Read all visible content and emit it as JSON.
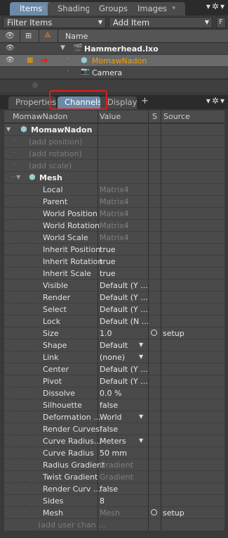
{
  "top_tabs": [
    {
      "label": "Items",
      "active": true
    },
    {
      "label": "Shading",
      "active": false
    },
    {
      "label": "Groups",
      "active": false
    },
    {
      "label": "Images",
      "active": false
    }
  ],
  "filter": {
    "label": "Filter Items",
    "add_item": "Add Item",
    "f_button": "F"
  },
  "items_header": {
    "name": "Name"
  },
  "items": [
    {
      "name": "Hammerhead.lxo",
      "type": "scene"
    },
    {
      "name": "MomawNadon",
      "type": "mesh",
      "selected": true
    },
    {
      "name": "Camera",
      "type": "camera"
    }
  ],
  "bottom_tabs": [
    {
      "label": "Properties",
      "active": false
    },
    {
      "label": "Channels",
      "active": true
    },
    {
      "label": "Display",
      "active": false
    },
    {
      "label": "+",
      "active": false
    }
  ],
  "channel_header": {
    "name_col": "MomawNadon",
    "value_col": "Value",
    "s_col": "S",
    "source_col": "Source"
  },
  "channels": [
    {
      "label": "MomawNadon",
      "value": "",
      "style": "bold",
      "indent": 0,
      "icon": "mesh"
    },
    {
      "label": "(add position)",
      "value": "",
      "style": "dim",
      "indent": 1
    },
    {
      "label": "(add rotation)",
      "value": "",
      "style": "dim",
      "indent": 1
    },
    {
      "label": "(add scale)",
      "value": "",
      "style": "dim",
      "indent": 1
    },
    {
      "label": "Mesh",
      "value": "",
      "style": "bold",
      "indent": 1,
      "icon": "mesh"
    },
    {
      "label": "Local",
      "value": "Matrix4",
      "value_dim": true,
      "indent": 2
    },
    {
      "label": "Parent",
      "value": "Matrix4",
      "value_dim": true,
      "indent": 2
    },
    {
      "label": "World Position",
      "value": "Matrix4",
      "value_dim": true,
      "indent": 2
    },
    {
      "label": "World Rotation",
      "value": "Matrix4",
      "value_dim": true,
      "indent": 2
    },
    {
      "label": "World Scale",
      "value": "Matrix4",
      "value_dim": true,
      "indent": 2
    },
    {
      "label": "Inherit Position",
      "value": "true",
      "indent": 2
    },
    {
      "label": "Inherit Rotation",
      "value": "true",
      "indent": 2
    },
    {
      "label": "Inherit Scale",
      "value": "true",
      "indent": 2
    },
    {
      "label": "Visible",
      "value": "Default (Y ...",
      "indent": 2
    },
    {
      "label": "Render",
      "value": "Default (Y ...",
      "indent": 2
    },
    {
      "label": "Select",
      "value": "Default (Y ...",
      "indent": 2
    },
    {
      "label": "Lock",
      "value": "Default (N ...",
      "indent": 2
    },
    {
      "label": "Size",
      "value": "1.0",
      "indent": 2,
      "circle": true,
      "source": "setup"
    },
    {
      "label": "Shape",
      "value": "Default",
      "indent": 2,
      "dropdown": true
    },
    {
      "label": "Link",
      "value": "(none)",
      "indent": 2,
      "dropdown": true
    },
    {
      "label": "Center",
      "value": "Default (Y ...",
      "indent": 2
    },
    {
      "label": "Pivot",
      "value": "Default (Y ...",
      "indent": 2
    },
    {
      "label": "Dissolve",
      "value": "0.0 %",
      "indent": 2
    },
    {
      "label": "Silhouette",
      "value": "false",
      "indent": 2
    },
    {
      "label": "Deformation ...",
      "value": "World",
      "indent": 2,
      "dropdown": true
    },
    {
      "label": "Render Curves",
      "value": "false",
      "indent": 2
    },
    {
      "label": "Curve Radius...",
      "value": "Meters",
      "indent": 2,
      "dropdown": true
    },
    {
      "label": "Curve Radius",
      "value": "50 mm",
      "indent": 2
    },
    {
      "label": "Radius Gradient",
      "value": "Gradient",
      "value_dim": true,
      "indent": 2
    },
    {
      "label": "Twist Gradient",
      "value": "Gradient",
      "value_dim": true,
      "indent": 2
    },
    {
      "label": "Render Curv ...",
      "value": "false",
      "indent": 2
    },
    {
      "label": "Sides",
      "value": "8",
      "indent": 2
    },
    {
      "label": "Mesh",
      "value": "Mesh",
      "value_dim": true,
      "indent": 2,
      "circle": true,
      "source": "setup"
    },
    {
      "label": "(add user chan ...",
      "value": "",
      "style": "dim",
      "indent": 2
    }
  ]
}
